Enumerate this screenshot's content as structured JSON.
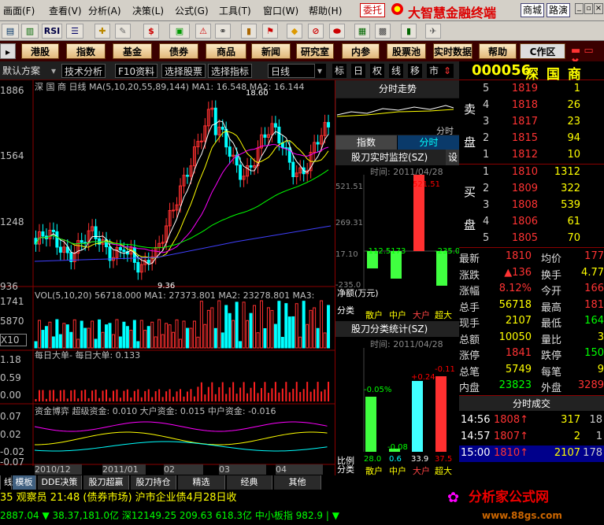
{
  "menu": {
    "items": [
      "画面(F)",
      "查看(V)",
      "分析(A)",
      "决策(L)",
      "公式(G)",
      "工具(T)",
      "窗口(W)",
      "帮助(H)"
    ],
    "entrust": "委托",
    "app_title": "大智慧金融终端",
    "mall": "商城",
    "roadshow": "路演"
  },
  "toolbar": {
    "rsi": "RSI"
  },
  "quickbar": {
    "items": [
      "港股",
      "指数",
      "基金",
      "债券",
      "商品",
      "新闻",
      "研究室",
      "内参",
      "股票池",
      "实时数据",
      "帮助"
    ],
    "workspace": "C作区"
  },
  "row3": {
    "default_scheme": "默认方案",
    "tech": "技术分析",
    "f10": "F10资料",
    "select_stock": "选择股票",
    "select_indicator": "选择指标",
    "daily": "日线",
    "small": [
      "标",
      "日",
      "权",
      "线",
      "移",
      "市"
    ]
  },
  "kline": {
    "label": "深 国 商 日线 MA(5,10,20,55,89,144) MA1: 16.548 MA2: 16.144",
    "prices": [
      "1886",
      "1564",
      "1248",
      "936"
    ],
    "high_mark": "18.60",
    "low_mark": "9.36"
  },
  "vol": {
    "label": "VOL(5,10,20) 56718.000 MA1: 27373.801 MA2: 23278.801 MA3:",
    "axis": [
      "1741",
      "5870",
      "X10"
    ]
  },
  "bigorder": {
    "label": "每日大单- 每日大单: 0.133",
    "axis": [
      "1.18",
      "0.59",
      "0.00"
    ]
  },
  "fund": {
    "label": "资金博弈 超级资金: 0.010 大户资金: 0.015 中户资金: -0.016",
    "axis": [
      "0.07",
      "0.02",
      "-0.02",
      "-0.07"
    ]
  },
  "xaxis": [
    "2010/12",
    "2011/01",
    "02",
    "03",
    "04"
  ],
  "stock": {
    "code": "000056",
    "name": "深 国 商"
  },
  "orderbook": {
    "sell_label": [
      "卖",
      "盘"
    ],
    "buy_label": [
      "买",
      "盘"
    ],
    "sell": [
      {
        "n": "5",
        "p": "1819",
        "v": "1"
      },
      {
        "n": "4",
        "p": "1818",
        "v": "26"
      },
      {
        "n": "3",
        "p": "1817",
        "v": "23"
      },
      {
        "n": "2",
        "p": "1815",
        "v": "94"
      },
      {
        "n": "1",
        "p": "1812",
        "v": "10"
      }
    ],
    "buy": [
      {
        "n": "1",
        "p": "1810",
        "v": "1312"
      },
      {
        "n": "2",
        "p": "1809",
        "v": "322"
      },
      {
        "n": "3",
        "p": "1808",
        "v": "539"
      },
      {
        "n": "4",
        "p": "1806",
        "v": "61"
      },
      {
        "n": "5",
        "p": "1805",
        "v": "70"
      }
    ]
  },
  "quote": [
    {
      "l1": "最新",
      "v1": "1810",
      "l2": "均价",
      "v2": "177"
    },
    {
      "l1": "涨跌",
      "v1": "▲136",
      "l2": "换手",
      "v2": "4.77"
    },
    {
      "l1": "涨幅",
      "v1": "8.12%",
      "l2": "今开",
      "v2": "166"
    },
    {
      "l1": "总手",
      "v1": "56718",
      "l2": "最高",
      "v2": "181"
    },
    {
      "l1": "现手",
      "v1": "2107",
      "l2": "最低",
      "v2": "164"
    },
    {
      "l1": "总额",
      "v1": "10050",
      "l2": "量比",
      "v2": "3"
    },
    {
      "l1": "涨停",
      "v1": "1841",
      "l2": "跌停",
      "v2": "150"
    },
    {
      "l1": "总笔",
      "v1": "5749",
      "l2": "每笔",
      "v2": "9"
    },
    {
      "l1": "内盘",
      "v1": "23823",
      "l2": "外盘",
      "v2": "3289"
    }
  ],
  "trades": {
    "title": "分时成交",
    "rows": [
      {
        "t": "14:56",
        "p": "1808↑",
        "v": "317",
        "n": "18"
      },
      {
        "t": "14:57",
        "p": "1807↑",
        "v": "2",
        "n": "1"
      },
      {
        "t": "15:00",
        "p": "1810↑",
        "v": "2107",
        "n": "178"
      }
    ]
  },
  "mid": {
    "fenshi": "分时走势",
    "zhishu": "指数",
    "fenshi_tab": "分时",
    "fenshi_label": "分时",
    "monitor_title": "股刀实时监控(SZ)",
    "monitor_set": "设",
    "monitor_time": "时间: 2011/04/28",
    "monitor_axis": [
      "521.51",
      "269.31",
      "17.10",
      "-235.0"
    ],
    "monitor_labels": [
      "-112.5173",
      "521.51",
      "-235.0"
    ],
    "jingliu": "净额(万元)",
    "fenlei": "分类",
    "cats": [
      "散户",
      "中户",
      "大户",
      "超大"
    ],
    "classify_title": "股刀分类统计(SZ)",
    "classify_time": "时间: 2011/04/28",
    "classify_labels": [
      "-0.05%",
      "-0.08",
      "+0.24",
      "-0.11"
    ],
    "bili": "比例",
    "bili_vals": [
      "28.0",
      "0.6",
      "33.9",
      "37.5"
    ]
  },
  "status": {
    "xian": "线",
    "tabs": [
      "模板",
      "DDE决策",
      "股刀超赢",
      "股刀持仓",
      "精选",
      "经典",
      "其他"
    ]
  },
  "ticker1": {
    "text": "35 观察员    21:48 (债券市场) 沪市企业债4月28日收",
    "brand": "分析家公式网"
  },
  "ticker2": {
    "text": "2887.04 ▼ 38.37,181.0亿 深12149.25 209.63 618.3亿 中小板指 982.9 | ▼",
    "url": "www.88gs.com"
  },
  "chart_data": {
    "type": "table",
    "candles_note": "",
    "x": [
      "2010/12",
      "2011/01",
      "02",
      "03",
      "04"
    ]
  }
}
